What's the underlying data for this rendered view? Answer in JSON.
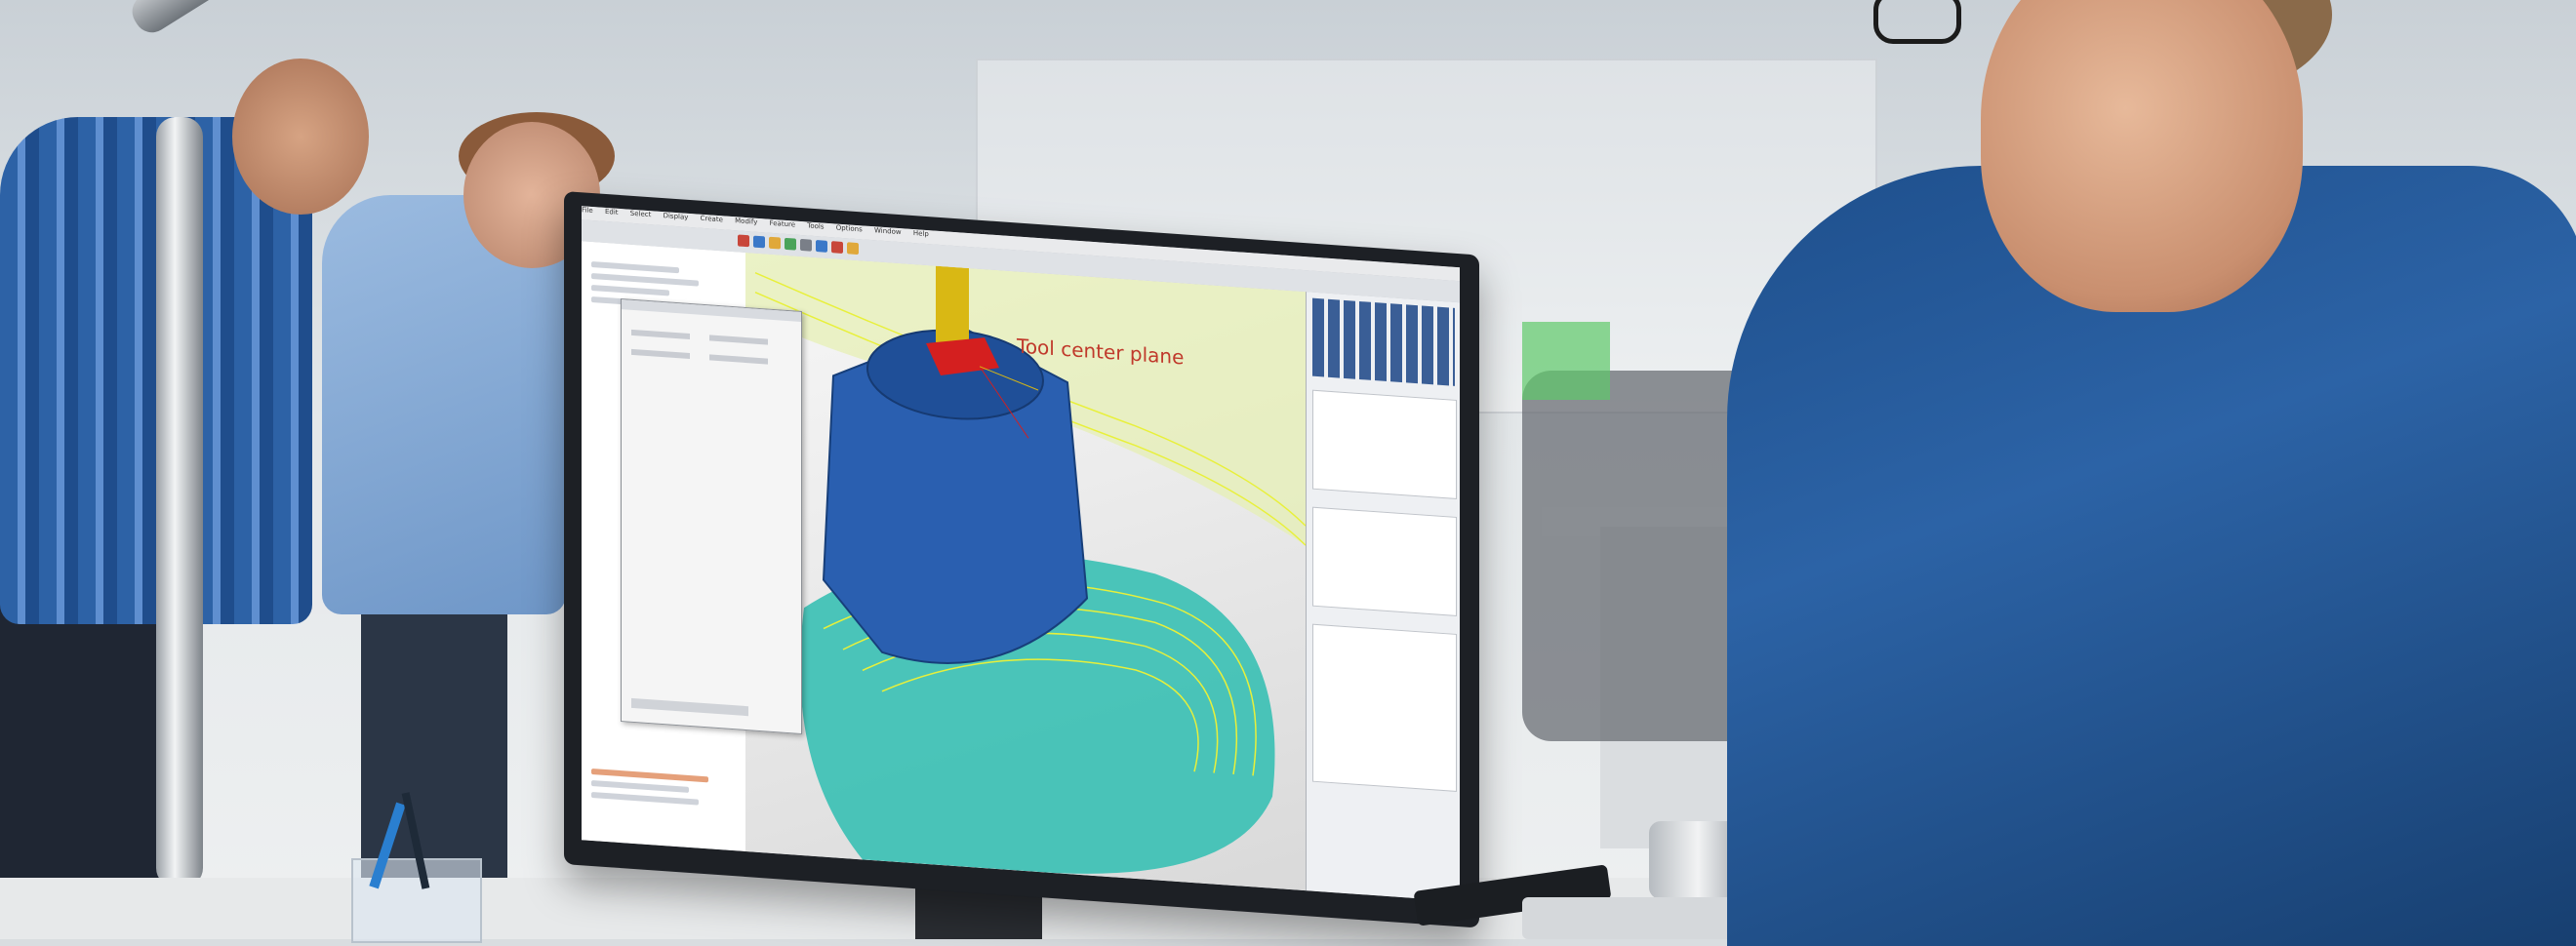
{
  "scene": "Engineer at a desk looking at a monitor showing a CAM application with a 3D part and toolpaths",
  "screen": {
    "menu_items": [
      "File",
      "Edit",
      "Select",
      "Display",
      "Create",
      "Modify",
      "Feature",
      "Tools",
      "Options",
      "Window",
      "Help"
    ],
    "viewport_label": "Tool center plane",
    "colors": {
      "part": "#2a5fb0",
      "tool": "#d9b814",
      "toolpath": "#e8f03a",
      "stock": "#39c0b4",
      "plane_marker": "#d41f1f"
    }
  }
}
